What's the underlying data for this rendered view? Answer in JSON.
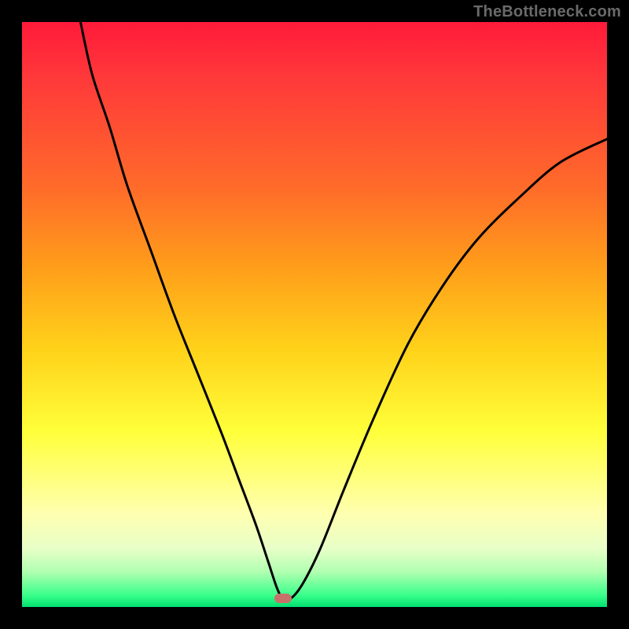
{
  "watermark": "TheBottleneck.com",
  "colors": {
    "frame": "#000000",
    "gradient_top": "#ff1a3a",
    "gradient_bottom": "#00e070",
    "curve": "#000000",
    "marker": "#c8716a"
  },
  "chart_data": {
    "type": "line",
    "title": "",
    "xlabel": "",
    "ylabel": "",
    "xlim": [
      0,
      100
    ],
    "ylim": [
      0,
      100
    ],
    "series": [
      {
        "name": "bottleneck-curve",
        "x": [
          10,
          12,
          15,
          18,
          22,
          26,
          30,
          34,
          37,
          40,
          42,
          43.6,
          44.6,
          46,
          48,
          51,
          55,
          60,
          66,
          72,
          78,
          85,
          92,
          100
        ],
        "values": [
          100,
          91,
          82,
          72,
          61,
          50,
          40,
          30,
          22,
          14,
          8,
          3.2,
          1.5,
          1.5,
          4,
          10,
          20,
          32,
          45,
          55,
          63,
          70,
          76,
          80
        ]
      }
    ],
    "annotations": [
      {
        "name": "optimal-marker",
        "x": 44.6,
        "y": 1.5
      }
    ],
    "grid": false,
    "legend": false
  }
}
